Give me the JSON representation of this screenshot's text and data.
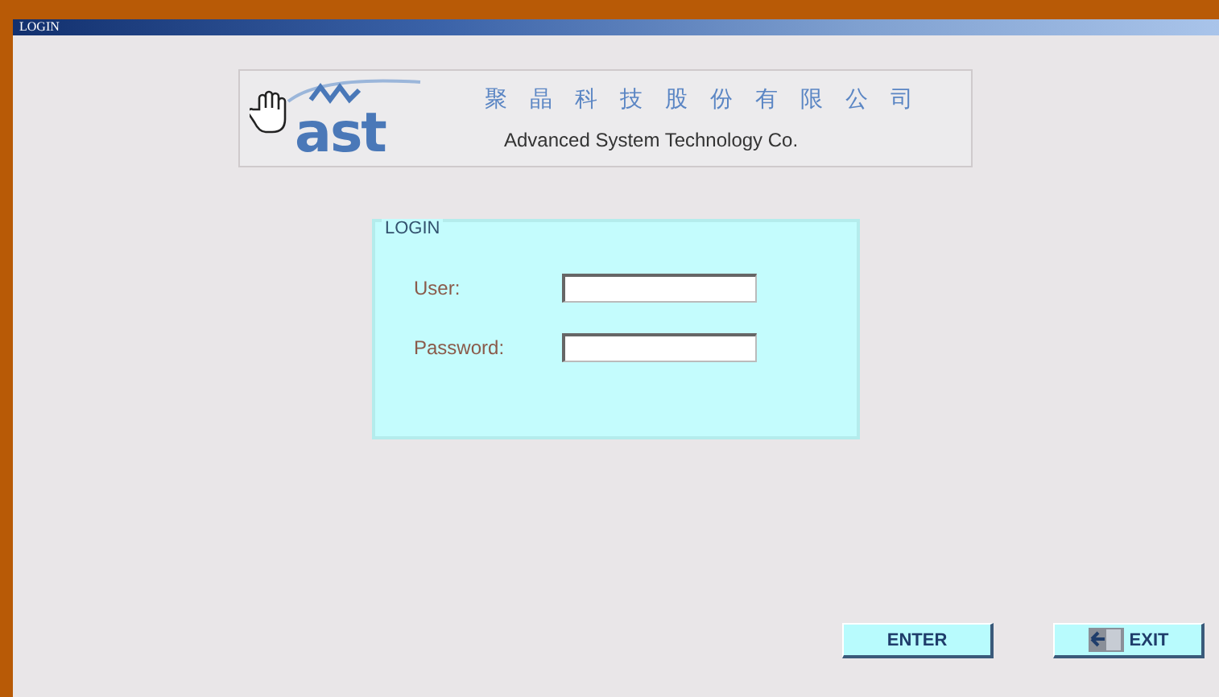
{
  "window": {
    "title": "LOGIN"
  },
  "logo": {
    "mark": "ast",
    "company_chinese": "聚晶科技股份有限公司",
    "company_english": "Advanced System Technology Co."
  },
  "login": {
    "legend": "LOGIN",
    "fields": [
      {
        "label": "User:"
      },
      {
        "label": "Password:"
      }
    ]
  },
  "buttons": [
    {
      "kind": "plain",
      "label": "ENTER"
    },
    {
      "kind": "icon",
      "label": "EXIT"
    }
  ]
}
